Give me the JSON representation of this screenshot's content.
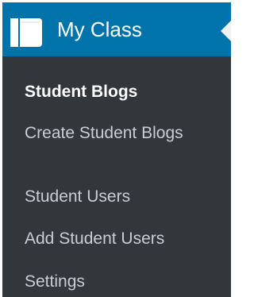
{
  "menu": {
    "title": "My Class",
    "icon": "book-icon",
    "collapse_icon": "collapse-arrow-icon",
    "colors": {
      "header_bg": "#0073aa",
      "submenu_bg": "#32373c",
      "item_text": "#c8ced3",
      "current_text": "#ffffff"
    },
    "items": [
      {
        "label": "Student Blogs",
        "current": true
      },
      {
        "label": "Create Student Blogs",
        "current": false
      },
      {
        "label": "Student Users",
        "current": false
      },
      {
        "label": "Add Student Users",
        "current": false
      },
      {
        "label": "Settings",
        "current": false
      }
    ]
  }
}
